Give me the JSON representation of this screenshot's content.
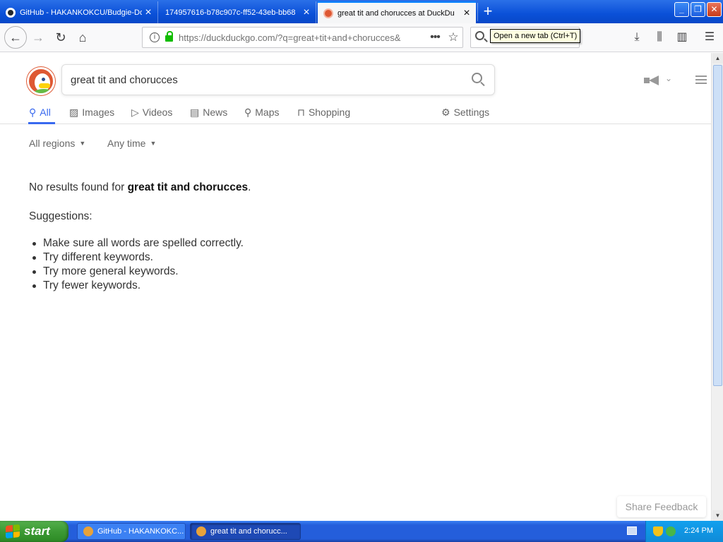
{
  "browser": {
    "tabs": [
      {
        "label": "GitHub - HAKANKOKCU/Budgie-Do",
        "active": false
      },
      {
        "label": "174957616-b78c907c-ff52-43eb-bb68",
        "active": false
      },
      {
        "label": "great tit and chorucces at DuckDu",
        "active": true
      }
    ],
    "new_tab_symbol": "+",
    "window_buttons": {
      "minimize": "_",
      "restore": "❐",
      "close": "✕"
    },
    "url": "https://duckduckgo.com/?q=great+tit+and+chorucces&",
    "tooltip": "Open a new tab (Ctrl+T)"
  },
  "search": {
    "query": "great tit and chorucces",
    "tabs": [
      {
        "label": "All",
        "icon": "search-icon",
        "active": true
      },
      {
        "label": "Images",
        "icon": "images-icon",
        "active": false
      },
      {
        "label": "Videos",
        "icon": "videos-icon",
        "active": false
      },
      {
        "label": "News",
        "icon": "news-icon",
        "active": false
      },
      {
        "label": "Maps",
        "icon": "map-pin-icon",
        "active": false
      },
      {
        "label": "Shopping",
        "icon": "shopping-bag-icon",
        "active": false
      }
    ],
    "settings_label": "Settings",
    "filters": {
      "region": "All regions",
      "time": "Any time"
    }
  },
  "results": {
    "no_results_prefix": "No results found for ",
    "no_results_query": "great tit and chorucces",
    "no_results_suffix": ".",
    "suggestions_title": "Suggestions:",
    "suggestions": [
      "Make sure all words are spelled correctly.",
      "Try different keywords.",
      "Try more general keywords.",
      "Try fewer keywords."
    ]
  },
  "share_feedback": "Share Feedback",
  "taskbar": {
    "start_label": "start",
    "tasks": [
      {
        "label": "GitHub - HAKANKOKC...",
        "active": false
      },
      {
        "label": "great tit and chorucc...",
        "active": true
      }
    ],
    "clock": "2:24 PM"
  },
  "colors": {
    "accent": "#3969ef",
    "ddg_orange": "#de5833",
    "xp_blue": "#245edb",
    "start_green": "#3c9a34"
  }
}
